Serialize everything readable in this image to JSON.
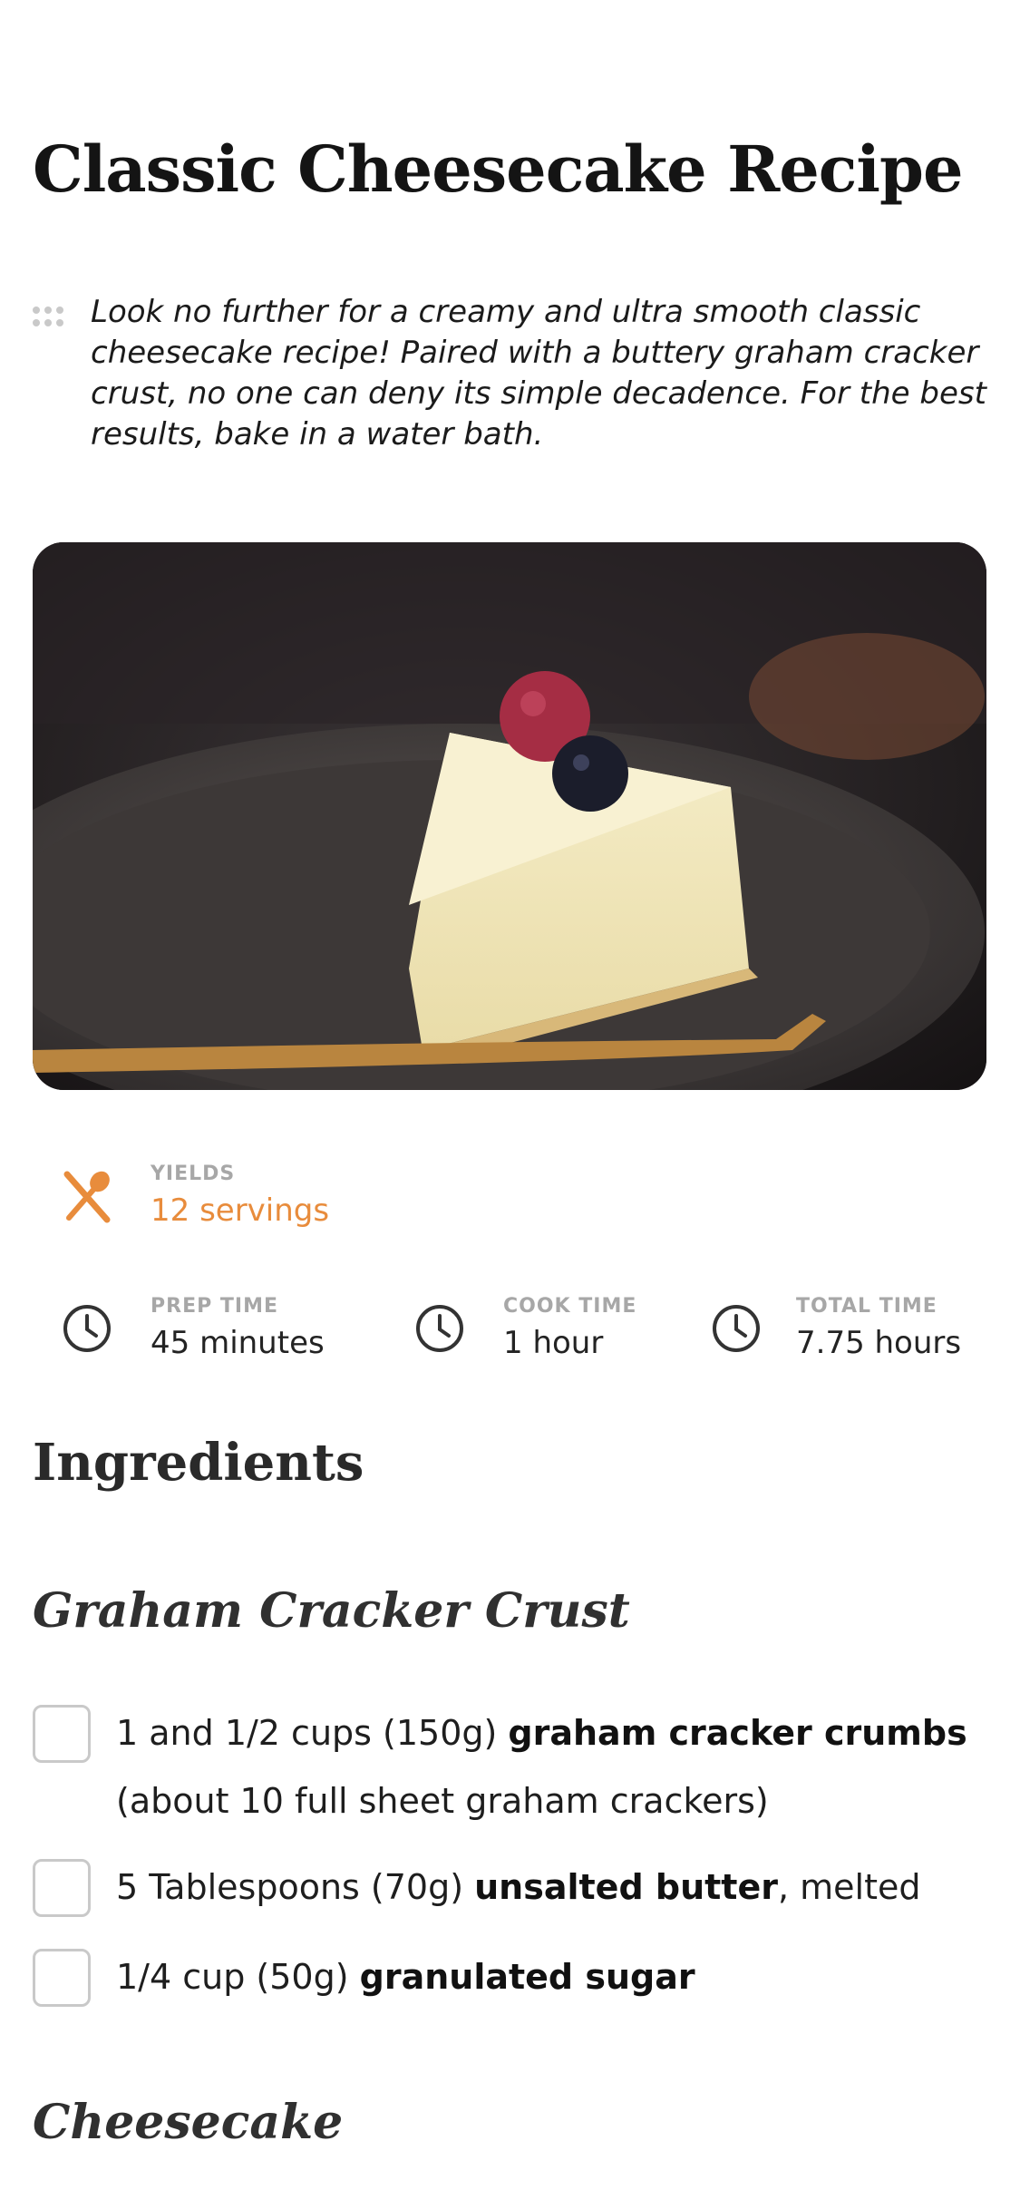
{
  "recipe": {
    "title": "Classic Cheesecake Recipe",
    "intro": "Look no further for a creamy and ultra smooth classic cheesecake recipe! Paired with a buttery graham cracker crust, no one can deny its simple decadence. For the best results, bake in a water bath."
  },
  "meta": {
    "yields": {
      "label": "YIELDS",
      "value": "12 servings",
      "icon": "utensils-icon"
    },
    "prep": {
      "label": "PREP TIME",
      "value": "45 minutes",
      "icon": "clock-icon"
    },
    "cook": {
      "label": "COOK TIME",
      "value": "1 hour",
      "icon": "clock-icon"
    },
    "total": {
      "label": "TOTAL TIME",
      "value": "7.75 hours",
      "icon": "clock-icon"
    }
  },
  "ingredients": {
    "title": "Ingredients",
    "groups": [
      {
        "title": "Graham Cracker Crust",
        "items": [
          {
            "amount": "1 and 1/2 cups (150g) ",
            "name": "graham cracker crumbs",
            "note": " (about 10 full sheet graham crackers)"
          },
          {
            "amount": "5 Tablespoons (70g) ",
            "name": "unsalted butter",
            "note": ", melted"
          },
          {
            "amount": "1/4 cup (50g) ",
            "name": "granulated sugar",
            "note": ""
          }
        ]
      },
      {
        "title": "Cheesecake",
        "items": []
      }
    ]
  },
  "colors": {
    "accent": "#e88c3c",
    "label": "#a7a7a7",
    "checkbox_border": "#c9c9c9"
  }
}
